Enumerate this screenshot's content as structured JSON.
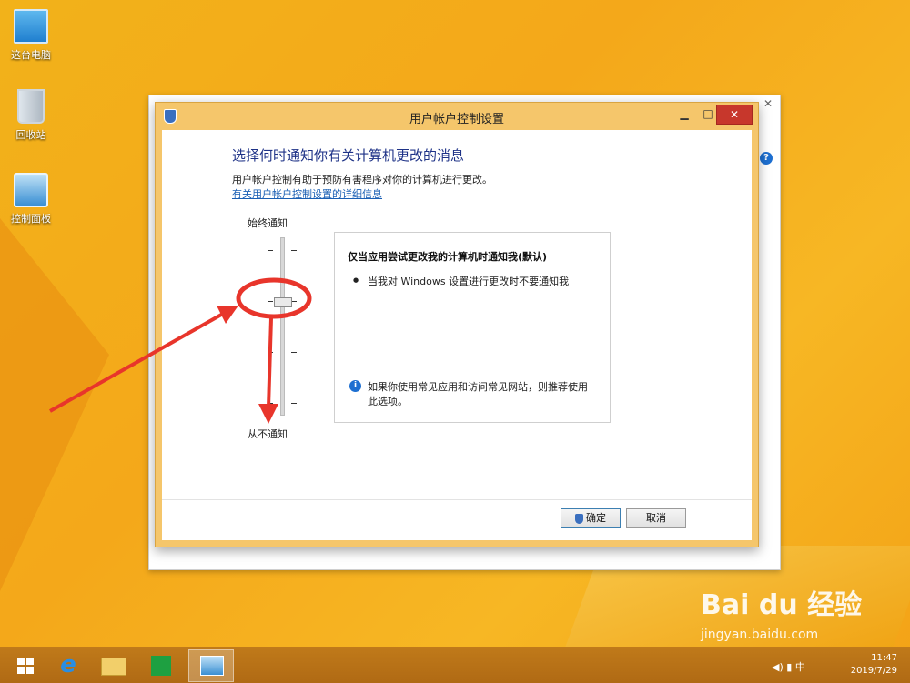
{
  "desktop": {
    "icons": [
      {
        "label": "这台电脑",
        "icon": "computer-icon"
      },
      {
        "label": "回收站",
        "icon": "recycle-bin-icon"
      },
      {
        "label": "控制面板",
        "icon": "control-panel-icon"
      }
    ]
  },
  "dialog": {
    "title": "用户帐户控制设置",
    "heading": "选择何时通知你有关计算机更改的消息",
    "description": "用户帐户控制有助于预防有害程序对你的计算机进行更改。",
    "link": "有关用户帐户控制设置的详细信息",
    "slider": {
      "top_label": "始终通知",
      "bottom_label": "从不通知",
      "levels": 4,
      "current_level": 3
    },
    "info": {
      "title": "仅当应用尝试更改我的计算机时通知我(默认)",
      "bullet": "当我对 Windows 设置进行更改时不要通知我",
      "note": "如果你使用常见应用和访问常见网站，则推荐使用此选项。"
    },
    "buttons": {
      "ok": "确定",
      "cancel": "取消"
    }
  },
  "taskbar": {
    "time": "11:47",
    "date": "2019/7/29",
    "ime": "中"
  },
  "watermark": {
    "brand": "Bai du 经验",
    "url": "jingyan.baidu.com"
  },
  "colors": {
    "accent": "#1e3287",
    "annotation": "#e8352b",
    "close": "#c7372c"
  }
}
